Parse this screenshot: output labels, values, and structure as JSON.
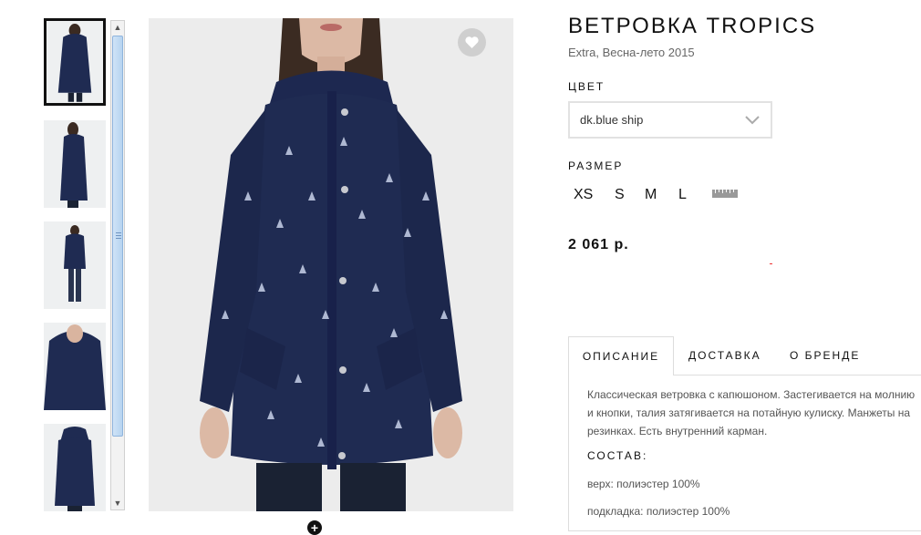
{
  "product": {
    "title": "ВЕТРОВКА TROPICS",
    "subtitle": "Extra, Весна-лето 2015",
    "price": "2 061 р."
  },
  "color": {
    "label": "ЦВЕТ",
    "selected": "dk.blue ship"
  },
  "size": {
    "label": "РАЗМЕР",
    "options": [
      "XS",
      "S",
      "M",
      "L"
    ]
  },
  "icons": {
    "favorite": "heart-icon",
    "zoom": "plus-icon",
    "size_chart": "ruler-icon",
    "dropdown": "chevron-down-icon"
  },
  "tabs": [
    {
      "label": "ОПИСАНИЕ",
      "active": true
    },
    {
      "label": "ДОСТАВКА",
      "active": false
    },
    {
      "label": "О БРЕНДЕ",
      "active": false
    }
  ],
  "description": {
    "text": "Классическая ветровка с капюшоном. Застегивается на молнию и кнопки, талия затягивается на потайную кулиску. Манжеты на резинках. Есть внутренний карман.",
    "composition_title": "СОСТАВ:",
    "composition": [
      "верх: полиэстер 100%",
      "подкладка: полиэстер 100%"
    ]
  },
  "colors": {
    "jacket": "#1f2b52",
    "background": "#ececec",
    "text": "#111111"
  }
}
